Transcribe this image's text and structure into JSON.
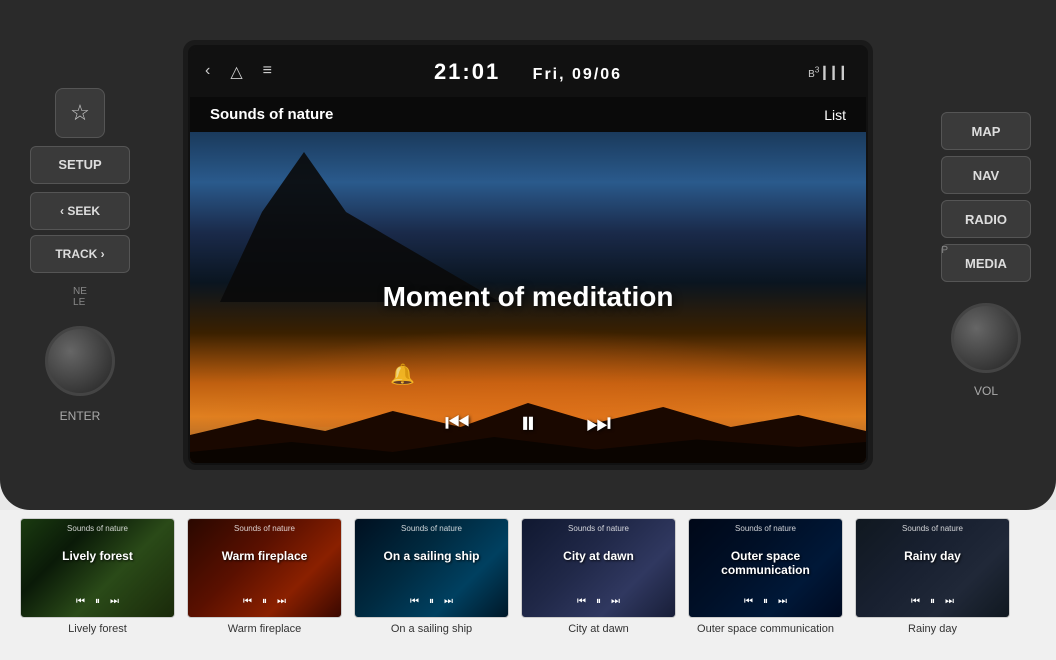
{
  "header": {
    "time": "21:01",
    "date": "Fri, 09/06",
    "app_name": "Sounds of nature",
    "list_label": "List"
  },
  "nav": {
    "back_icon": "‹",
    "home_icon": "△",
    "menu_icon": "≡"
  },
  "now_playing": {
    "title": "Moment of meditation",
    "controls": {
      "prev_icon": "⏮",
      "pause_icon": "⏸",
      "next_icon": "⏭"
    }
  },
  "left_panel": {
    "star_icon": "☆",
    "setup_label": "SETUP",
    "seek_label": "‹ SEEK",
    "track_label": "TRACK ›",
    "enter_label": "ENTER"
  },
  "right_panel": {
    "map_label": "MAP",
    "nav_label": "NAV",
    "radio_label": "RADIO",
    "media_label": "MEDIA",
    "vol_label": "VOL"
  },
  "side_labels": {
    "left_top": "NE",
    "left_bottom": "LE",
    "right_label": "P"
  },
  "thumbnails": [
    {
      "id": 1,
      "app": "Sounds of nature",
      "title": "Lively forest",
      "caption": "Lively forest",
      "bg_class": "thumb-bg-1"
    },
    {
      "id": 2,
      "app": "Sounds of nature",
      "title": "Warm fireplace",
      "caption": "Warm fireplace",
      "bg_class": "thumb-bg-2"
    },
    {
      "id": 3,
      "app": "Sounds of nature",
      "title": "On a sailing ship",
      "caption": "On a sailing ship",
      "bg_class": "thumb-bg-3"
    },
    {
      "id": 4,
      "app": "Sounds of nature",
      "title": "City at dawn",
      "caption": "City at dawn",
      "bg_class": "thumb-bg-4"
    },
    {
      "id": 5,
      "app": "Sounds of nature",
      "title": "Outer space communication",
      "caption": "Outer space communication",
      "bg_class": "thumb-bg-5"
    },
    {
      "id": 6,
      "app": "Sounds of nature",
      "title": "Rainy day",
      "caption": "Rainy day",
      "bg_class": "thumb-bg-6"
    }
  ]
}
